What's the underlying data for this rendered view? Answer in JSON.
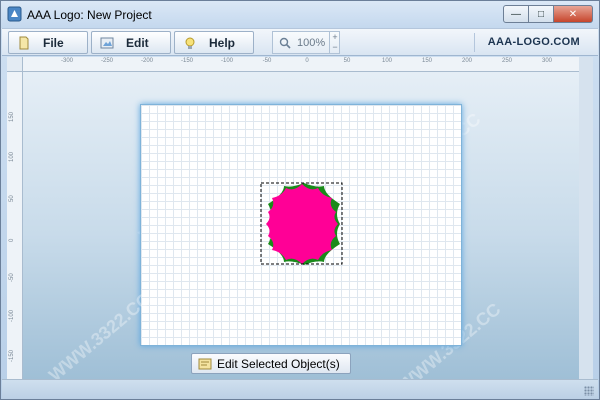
{
  "window": {
    "title": "AAA Logo: New Project"
  },
  "titlebar_buttons": {
    "minimize": "—",
    "maximize": "□",
    "close": "✕"
  },
  "menu": [
    {
      "label": "File",
      "icon": "document-icon"
    },
    {
      "label": "Edit",
      "icon": "edit-image-icon"
    },
    {
      "label": "Help",
      "icon": "lightbulb-icon"
    }
  ],
  "zoom": {
    "value": "100%",
    "up": "+",
    "down": "−"
  },
  "brand": "AAA-LOGO.COM",
  "ruler_h": [
    "-300",
    "-250",
    "-200",
    "-150",
    "-100",
    "-50",
    "0",
    "50",
    "100",
    "150",
    "200",
    "250",
    "300"
  ],
  "ruler_v": [
    "150",
    "100",
    "50",
    "0",
    "-50",
    "-100",
    "-150"
  ],
  "edit_button": {
    "label": "Edit Selected Object(s)"
  },
  "watermark": "WWW.3322.CC",
  "colors": {
    "shape_fill": "#ff0096",
    "shape_shadow": "#1a8a1a",
    "canvas_glow": "#5ea7df"
  }
}
